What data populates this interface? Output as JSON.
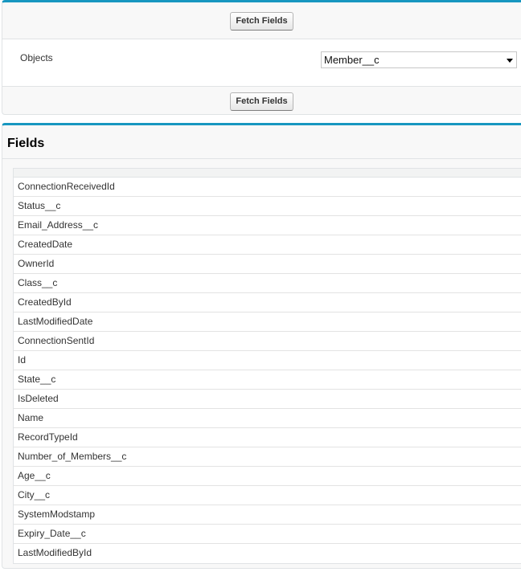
{
  "top_section": {
    "fetch_button_top": "Fetch Fields",
    "objects_label": "Objects",
    "objects_select_value": "Member__c",
    "fetch_button_bottom": "Fetch Fields"
  },
  "fields_section": {
    "title": "Fields",
    "rows": [
      "ConnectionReceivedId",
      "Status__c",
      "Email_Address__c",
      "CreatedDate",
      "OwnerId",
      "Class__c",
      "CreatedById",
      "LastModifiedDate",
      "ConnectionSentId",
      "Id",
      "State__c",
      "IsDeleted",
      "Name",
      "RecordTypeId",
      "Number_of_Members__c",
      "Age__c",
      "City__c",
      "SystemModstamp",
      "Expiry_Date__c",
      "LastModifiedById"
    ]
  },
  "colors": {
    "accent": "#1797c0",
    "panel_background": "#f8f8f8",
    "border": "#e0e3e5"
  }
}
